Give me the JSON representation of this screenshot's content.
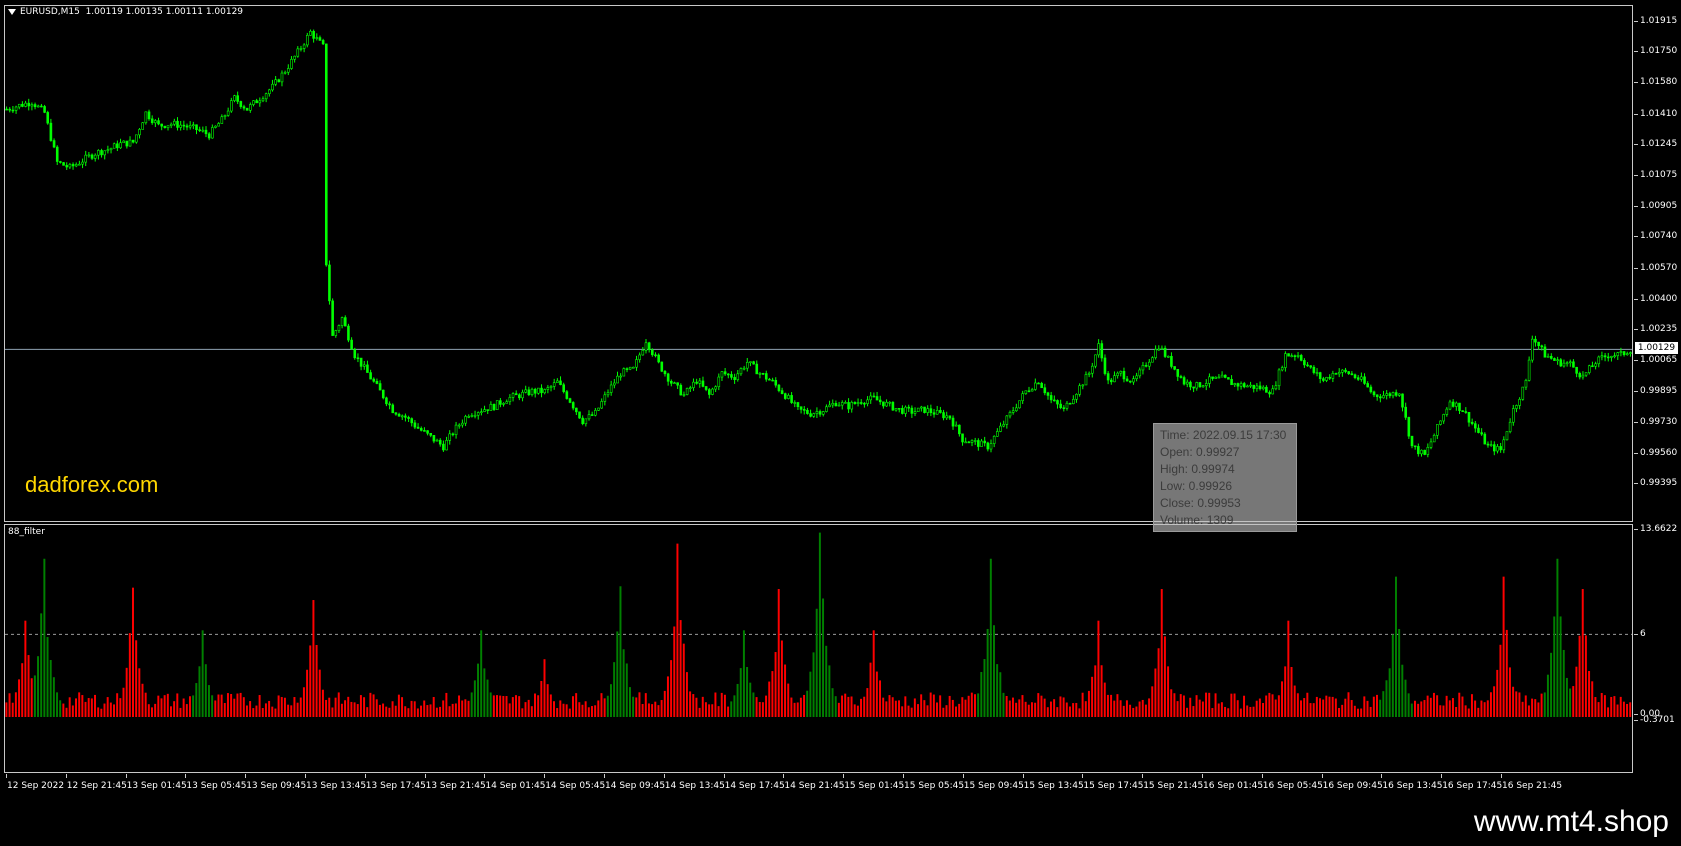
{
  "symbol_header": {
    "symbol": "EURUSD,M15",
    "ohlc": "1.00119 1.00135 1.00111 1.00129"
  },
  "watermark": "dadforex.com",
  "footer_brand": "www.mt4.shop",
  "indicator": {
    "name": "88_filter"
  },
  "tooltip": {
    "time": "Time: 2022.09.15 17:30",
    "open": "Open: 0.99927",
    "high": "High: 0.99974",
    "low": "Low:  0.99926",
    "close": "Close: 0.99953",
    "volume": "Volume: 1309"
  },
  "colors": {
    "background": "#000000",
    "bull_candle": "#00ff00",
    "indicator_up": "#008000",
    "indicator_down": "#ff0000",
    "current_price_line": "#8fa3b3",
    "watermark": "#ffd700"
  },
  "price_axis": {
    "labels": [
      "1.01915",
      "1.01750",
      "1.01580",
      "1.01410",
      "1.01245",
      "1.01075",
      "1.00905",
      "1.00740",
      "1.00570",
      "1.00400",
      "1.00235",
      "1.00065",
      "0.99895",
      "0.99730",
      "0.99560",
      "0.99395"
    ],
    "current_price": "1.00129"
  },
  "indicator_axis": {
    "max_label": "13.6622",
    "level_label": "6",
    "zero_label": "0.00",
    "min_label": "-0.3701"
  },
  "time_axis": {
    "labels": [
      "12 Sep 2022",
      "12 Sep 21:45",
      "13 Sep 01:45",
      "13 Sep 05:45",
      "13 Sep 09:45",
      "13 Sep 13:45",
      "13 Sep 17:45",
      "13 Sep 21:45",
      "14 Sep 01:45",
      "14 Sep 05:45",
      "14 Sep 09:45",
      "14 Sep 13:45",
      "14 Sep 17:45",
      "14 Sep 21:45",
      "15 Sep 01:45",
      "15 Sep 05:45",
      "15 Sep 09:45",
      "15 Sep 13:45",
      "15 Sep 17:45",
      "15 Sep 21:45",
      "16 Sep 01:45",
      "16 Sep 05:45",
      "16 Sep 09:45",
      "16 Sep 13:45",
      "16 Sep 17:45",
      "16 Sep 21:45"
    ]
  },
  "chart_data": [
    {
      "type": "candlestick",
      "title": "EURUSD,M15",
      "ylim": [
        0.99395,
        1.02
      ],
      "current_price": 1.00129,
      "close_path": [
        [
          0,
          1.0144
        ],
        [
          8,
          1.0148
        ],
        [
          12,
          1.0142
        ],
        [
          16,
          1.0115
        ],
        [
          20,
          1.0112
        ],
        [
          24,
          1.0116
        ],
        [
          28,
          1.012
        ],
        [
          32,
          1.0122
        ],
        [
          36,
          1.0125
        ],
        [
          40,
          1.0126
        ],
        [
          44,
          1.0142
        ],
        [
          48,
          1.0135
        ],
        [
          52,
          1.0136
        ],
        [
          56,
          1.0135
        ],
        [
          60,
          1.0133
        ],
        [
          64,
          1.013
        ],
        [
          68,
          1.0138
        ],
        [
          72,
          1.015
        ],
        [
          76,
          1.0144
        ],
        [
          80,
          1.015
        ],
        [
          84,
          1.0156
        ],
        [
          88,
          1.0165
        ],
        [
          92,
          1.0175
        ],
        [
          96,
          1.0186
        ],
        [
          100,
          1.0178
        ],
        [
          101,
          1.006
        ],
        [
          103,
          1.002
        ],
        [
          106,
          1.003
        ],
        [
          110,
          1.001
        ],
        [
          114,
          1.0
        ],
        [
          118,
          0.999
        ],
        [
          122,
          0.998
        ],
        [
          126,
          0.9976
        ],
        [
          130,
          0.997
        ],
        [
          134,
          0.9965
        ],
        [
          138,
          0.996
        ],
        [
          142,
          0.997
        ],
        [
          146,
          0.9978
        ],
        [
          150,
          0.998
        ],
        [
          154,
          0.9982
        ],
        [
          158,
          0.9986
        ],
        [
          162,
          0.9988
        ],
        [
          166,
          0.999
        ],
        [
          170,
          0.999
        ],
        [
          174,
          0.9995
        ],
        [
          178,
          0.9985
        ],
        [
          182,
          0.9974
        ],
        [
          186,
          0.9978
        ],
        [
          190,
          0.999
        ],
        [
          194,
          1.0
        ],
        [
          198,
          1.0002
        ],
        [
          202,
          1.0018
        ],
        [
          206,
          1.0005
        ],
        [
          210,
          0.9995
        ],
        [
          214,
          0.9988
        ],
        [
          218,
          0.9996
        ],
        [
          222,
          0.9988
        ],
        [
          226,
          1.0
        ],
        [
          230,
          0.9998
        ],
        [
          234,
          1.0006
        ],
        [
          238,
          1.0
        ],
        [
          242,
          0.9995
        ],
        [
          246,
          0.9988
        ],
        [
          250,
          0.998
        ],
        [
          254,
          0.9978
        ],
        [
          258,
          0.998
        ],
        [
          262,
          0.9984
        ],
        [
          266,
          0.9982
        ],
        [
          270,
          0.9985
        ],
        [
          274,
          0.9986
        ],
        [
          278,
          0.9983
        ],
        [
          282,
          0.998
        ],
        [
          286,
          0.9979
        ],
        [
          290,
          0.998
        ],
        [
          294,
          0.9978
        ],
        [
          298,
          0.9976
        ],
        [
          302,
          0.9964
        ],
        [
          306,
          0.9962
        ],
        [
          310,
          0.996
        ],
        [
          314,
          0.997
        ],
        [
          318,
          0.998
        ],
        [
          322,
          0.999
        ],
        [
          326,
          0.9996
        ],
        [
          330,
          0.9985
        ],
        [
          334,
          0.998
        ],
        [
          338,
          0.999
        ],
        [
          342,
          1.0
        ],
        [
          345,
          1.0015
        ],
        [
          348,
          0.9995
        ],
        [
          352,
          1.0
        ],
        [
          356,
          0.9995
        ],
        [
          360,
          1.0005
        ],
        [
          364,
          1.0015
        ],
        [
          368,
          1.0005
        ],
        [
          372,
          0.9995
        ],
        [
          376,
          0.9993
        ],
        [
          380,
          0.9996
        ],
        [
          384,
          0.9997
        ],
        [
          388,
          0.9994
        ],
        [
          392,
          0.9993
        ],
        [
          396,
          0.9992
        ],
        [
          400,
          0.999
        ],
        [
          404,
          1.001
        ],
        [
          408,
          1.001
        ],
        [
          412,
          1.0002
        ],
        [
          416,
          0.9996
        ],
        [
          420,
          1.0001
        ],
        [
          424,
          1.0
        ],
        [
          428,
          0.9996
        ],
        [
          432,
          0.9988
        ],
        [
          436,
          0.9988
        ],
        [
          440,
          0.999
        ],
        [
          444,
          0.996
        ],
        [
          448,
          0.9955
        ],
        [
          452,
          0.997
        ],
        [
          456,
          0.9985
        ],
        [
          460,
          0.998
        ],
        [
          464,
          0.997
        ],
        [
          468,
          0.996
        ],
        [
          472,
          0.9958
        ],
        [
          476,
          0.998
        ],
        [
          480,
          0.9995
        ],
        [
          482,
          1.002
        ],
        [
          486,
          1.001
        ],
        [
          490,
          1.0006
        ],
        [
          494,
          1.0005
        ],
        [
          498,
          0.9998
        ],
        [
          502,
          1.0006
        ],
        [
          506,
          1.001
        ],
        [
          510,
          1.001
        ],
        [
          513,
          1.00129
        ]
      ]
    },
    {
      "type": "bar",
      "title": "88_filter",
      "ylim": [
        -0.3701,
        13.6622
      ],
      "level": 6,
      "peaks": [
        {
          "bar": 6,
          "value": 7.0,
          "color": "red"
        },
        {
          "bar": 12,
          "value": 11.5,
          "color": "green"
        },
        {
          "bar": 40,
          "value": 9.4,
          "color": "red"
        },
        {
          "bar": 62,
          "value": 6.3,
          "color": "green"
        },
        {
          "bar": 97,
          "value": 8.5,
          "color": "red"
        },
        {
          "bar": 150,
          "value": 6.3,
          "color": "green"
        },
        {
          "bar": 170,
          "value": 4.2,
          "color": "red"
        },
        {
          "bar": 194,
          "value": 9.5,
          "color": "green"
        },
        {
          "bar": 212,
          "value": 12.6,
          "color": "red"
        },
        {
          "bar": 233,
          "value": 6.3,
          "color": "green"
        },
        {
          "bar": 244,
          "value": 9.3,
          "color": "red"
        },
        {
          "bar": 257,
          "value": 13.4,
          "color": "green"
        },
        {
          "bar": 274,
          "value": 6.3,
          "color": "red"
        },
        {
          "bar": 311,
          "value": 11.5,
          "color": "green"
        },
        {
          "bar": 345,
          "value": 7.0,
          "color": "red"
        },
        {
          "bar": 365,
          "value": 9.3,
          "color": "red"
        },
        {
          "bar": 405,
          "value": 7.0,
          "color": "red"
        },
        {
          "bar": 439,
          "value": 10.2,
          "color": "green"
        },
        {
          "bar": 473,
          "value": 10.2,
          "color": "red"
        },
        {
          "bar": 490,
          "value": 11.5,
          "color": "green"
        },
        {
          "bar": 498,
          "value": 9.3,
          "color": "red"
        }
      ]
    }
  ]
}
